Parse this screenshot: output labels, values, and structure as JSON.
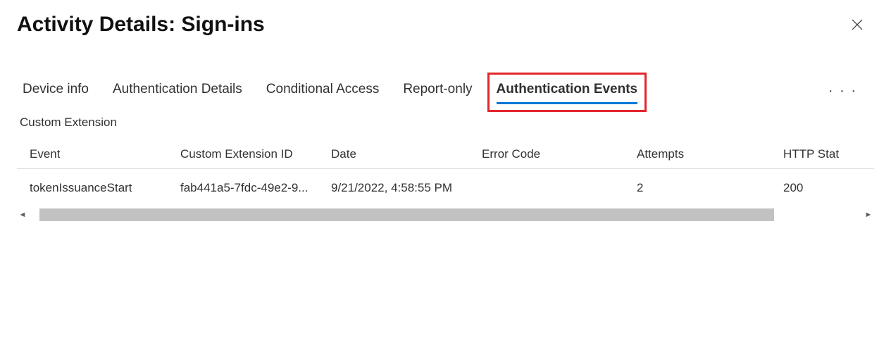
{
  "header": {
    "title": "Activity Details: Sign-ins"
  },
  "tabs": {
    "items": [
      {
        "label": "Device info"
      },
      {
        "label": "Authentication Details"
      },
      {
        "label": "Conditional Access"
      },
      {
        "label": "Report-only"
      },
      {
        "label": "Authentication Events"
      }
    ],
    "active_index": 4
  },
  "section": {
    "title": "Custom Extension"
  },
  "table": {
    "columns": {
      "event": "Event",
      "ext_id": "Custom Extension ID",
      "date": "Date",
      "error_code": "Error Code",
      "attempts": "Attempts",
      "http_stat": "HTTP Stat"
    },
    "rows": [
      {
        "event": "tokenIssuanceStart",
        "ext_id": "fab441a5-7fdc-49e2-9...",
        "date": "9/21/2022, 4:58:55 PM",
        "error_code": "",
        "attempts": "2",
        "http_stat": "200"
      }
    ]
  }
}
